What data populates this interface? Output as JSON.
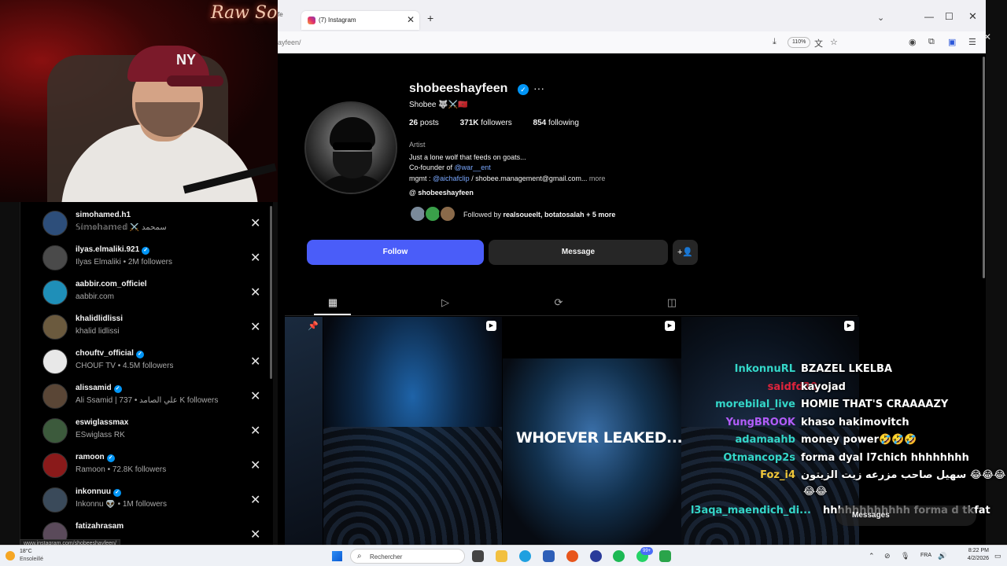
{
  "webcam": {
    "sign_text": "Raw Soueel",
    "cap_logo": "NY"
  },
  "following_list": [
    {
      "username": "simohamed.h1",
      "subtitle": "𝕊𝕚𝕞𝕠𝕙𝕒𝕞𝕖𝕕 ⚔️ سمحمد",
      "verified": false,
      "avatar_color": "#2d4e7a"
    },
    {
      "username": "ilyas.elmaliki.921",
      "subtitle": "Ilyas Elmaliki • 2M followers",
      "verified": true,
      "avatar_color": "#4a4a4a"
    },
    {
      "username": "aabbir.com_officiel",
      "subtitle": "aabbir.com",
      "verified": false,
      "avatar_color": "#1f8fb8"
    },
    {
      "username": "khalidlidlissi",
      "subtitle": "khalid lidlissi",
      "verified": false,
      "avatar_color": "#6b5a3e"
    },
    {
      "username": "chouftv_official",
      "subtitle": "CHOUF TV • 4.5M followers",
      "verified": true,
      "avatar_color": "#e8e8e8"
    },
    {
      "username": "alissamid",
      "subtitle": "Ali Ssamid | 737 • علي الصامد K followers",
      "verified": true,
      "avatar_color": "#5a4636"
    },
    {
      "username": "eswiglassmax",
      "subtitle": "ESwiglass RK",
      "verified": false,
      "avatar_color": "#3c5a3c"
    },
    {
      "username": "ramoon",
      "subtitle": "Ramoon • 72.8K followers",
      "verified": true,
      "avatar_color": "#8a1a1a"
    },
    {
      "username": "inkonnuu",
      "subtitle": "Inkonnu 👽 • 1M followers",
      "verified": true,
      "avatar_color": "#3a4a5a"
    },
    {
      "username": "fatizahrasam",
      "subtitle": "",
      "verified": false,
      "avatar_color": "#5a4a5a"
    }
  ],
  "remove_glyph": "✕",
  "status_url": "www.instagram.com/shobeeshayfeen/",
  "browser": {
    "prev_tab_label": "fe",
    "tab_title": "(7) Instagram",
    "tab_close": "✕",
    "new_tab": "+",
    "tab_list": "⌄",
    "win_min": "—",
    "win_max": "☐",
    "win_close": "✕",
    "url": "ayfeen/",
    "zoom": "110%",
    "outer_close": "✕"
  },
  "profile": {
    "username": "shobeeshayfeen",
    "verified_glyph": "✓",
    "more": "···",
    "display_name": "Shobee 🐺⚔️🇲🇦",
    "posts_count": "26",
    "posts_label": "posts",
    "followers_count": "371K",
    "followers_label": "followers",
    "following_count": "854",
    "following_label": "following",
    "category": "Artist",
    "bio_line1": "Just a lone wolf that feeds on goats...",
    "bio_line2_prefix": "Co-founder of ",
    "bio_line2_link": "@war__ent",
    "bio_line3_prefix": "mgmt : ",
    "bio_line3_link": "@aichafclip",
    "bio_line3_rest": " / shobee.management@gmail.com... ",
    "bio_more": "more",
    "threads_handle": "shobeeshayfeen",
    "followed_by_prefix": "Followed by ",
    "followed_by_names": "realsoueelt, botatosalah",
    "followed_by_suffix": " + 5 more",
    "follow_label": "Follow",
    "message_label": "Message",
    "suggest_icon": "+👤"
  },
  "posts": {
    "leak_text": "WHOEVER LEAKED..."
  },
  "chat": [
    {
      "user": "InkonnuRL",
      "msg": "BZAZEL LKELBA",
      "color": "#34d6c8"
    },
    {
      "user": "saidfd30",
      "msg": "kayojad",
      "color": "#e0243c"
    },
    {
      "user": "morebilal_live",
      "msg": "HOMIE THAT'S CRAAAAZY",
      "color": "#34d6c8"
    },
    {
      "user": "YungBROOK",
      "msg": "khaso hakimovitch",
      "color": "#b25cf7"
    },
    {
      "user": "adamaahb",
      "msg": "money power🤣🤣🤣",
      "color": "#34d6c8"
    },
    {
      "user": "Otmancop2s",
      "msg": "forma dyal l7chich hhhhhhhh",
      "color": "#34d6c8"
    },
    {
      "user": "Foz_i4",
      "msg": "سهيل صاحب مزرعه زيت الزيتون 😂😂😂",
      "color": "#f0c73a"
    },
    {
      "user": "",
      "msg": "😂😂",
      "color": "#ffffff"
    },
    {
      "user": "l3aqa_maendich_di...",
      "msg": "hhhhhhhhhhhh forma d tkfat",
      "color": "#34d6c8"
    }
  ],
  "messages_bar": "Messages",
  "taskbar": {
    "temp": "18°C",
    "weather": "Ensoleillé",
    "search_placeholder": "Rechercher",
    "notif_badge": "99+",
    "language": "FRA",
    "time": "8:22 PM",
    "date": "4/2/2026"
  }
}
